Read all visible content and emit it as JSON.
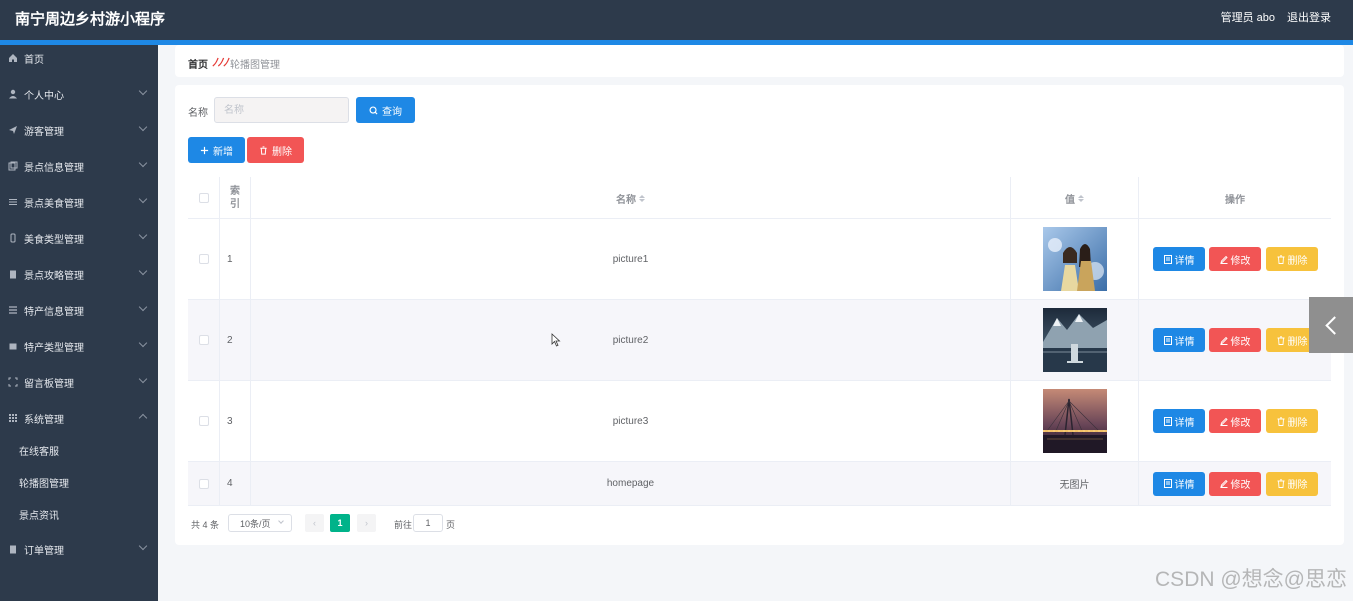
{
  "header": {
    "title": "南宁周边乡村游小程序",
    "admin": "管理员 abo",
    "logout": "退出登录"
  },
  "sidebar": {
    "items": [
      {
        "label": "首页",
        "icon": "home-icon"
      },
      {
        "label": "个人中心",
        "icon": "user-icon"
      },
      {
        "label": "游客管理",
        "icon": "send-icon"
      },
      {
        "label": "景点信息管理",
        "icon": "copy-icon"
      },
      {
        "label": "景点美食管理",
        "icon": "sliders-icon"
      },
      {
        "label": "美食类型管理",
        "icon": "mobile-icon"
      },
      {
        "label": "景点攻略管理",
        "icon": "clipboard-icon"
      },
      {
        "label": "特产信息管理",
        "icon": "list-icon"
      },
      {
        "label": "特产类型管理",
        "icon": "box-icon"
      },
      {
        "label": "留言板管理",
        "icon": "fullscreen-icon"
      },
      {
        "label": "系统管理",
        "icon": "grid-icon"
      },
      {
        "label": "订单管理",
        "icon": "order-icon"
      }
    ],
    "subitems": [
      "在线客服",
      "轮播图管理",
      "景点资讯"
    ]
  },
  "breadcrumb": {
    "home": "首页",
    "current": "轮播图管理"
  },
  "search": {
    "label": "名称",
    "placeholder": "名称",
    "query_label": "查询"
  },
  "actions": {
    "add_label": "新增",
    "delete_label": "删除"
  },
  "table": {
    "headers": {
      "index": "索引",
      "name": "名称",
      "value": "值",
      "ops": "操作"
    },
    "rows": [
      {
        "index": "1",
        "name": "picture1",
        "value": "image",
        "image": "people"
      },
      {
        "index": "2",
        "name": "picture2",
        "value": "image",
        "image": "mountain"
      },
      {
        "index": "3",
        "name": "picture3",
        "value": "image",
        "image": "bridge"
      },
      {
        "index": "4",
        "name": "homepage",
        "value": "无图片"
      }
    ],
    "op_labels": {
      "detail": "详情",
      "edit": "修改",
      "delete": "删除"
    }
  },
  "pagination": {
    "total": "共 4 条",
    "page_size": "10条/页",
    "current_page": "1",
    "goto_label": "前往",
    "goto_value": "1",
    "page_suffix": "页"
  },
  "watermark": "CSDN @想念@思恋",
  "colors": {
    "primary": "#1e88e5",
    "danger": "#f25555",
    "warning": "#f7c23c",
    "sidebar": "#2d3a4b",
    "pager_active": "#00b38a"
  }
}
